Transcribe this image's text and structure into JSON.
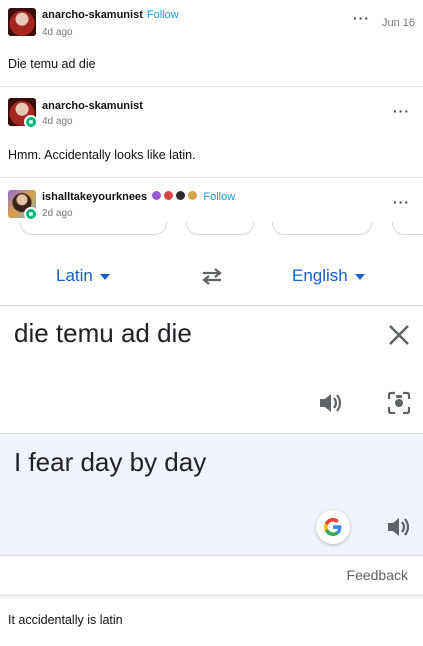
{
  "posts": [
    {
      "username": "anarcho-skamunist",
      "follow": "Follow",
      "time": "4d ago",
      "date": "Jun 16",
      "body": "Die temu ad die",
      "more_icon": "ellipsis-icon"
    },
    {
      "username": "anarcho-skamunist",
      "time": "4d ago",
      "body": "Hmm. Accidentally looks like latin.",
      "more_icon": "ellipsis-icon"
    },
    {
      "username": "ishalltakeyourknees",
      "follow": "Follow",
      "time": "2d ago",
      "more_icon": "ellipsis-icon"
    }
  ],
  "translate": {
    "source_lang": "Latin",
    "target_lang": "English",
    "source_text": "die temu ad die",
    "result_text": "I fear day by day",
    "feedback": "Feedback",
    "swap_icon": "swap-arrows-icon",
    "clear_icon": "close-icon",
    "listen_icon": "speaker-icon",
    "camera_icon": "lens-camera-icon",
    "google_icon": "google-g-icon"
  },
  "reply": {
    "body": "It accidentally is latin"
  },
  "colors": {
    "follow": "#1a9bdc",
    "lang": "#1a5fc7",
    "result_bg": "#f0f4fa",
    "badge": "#00b87a"
  }
}
